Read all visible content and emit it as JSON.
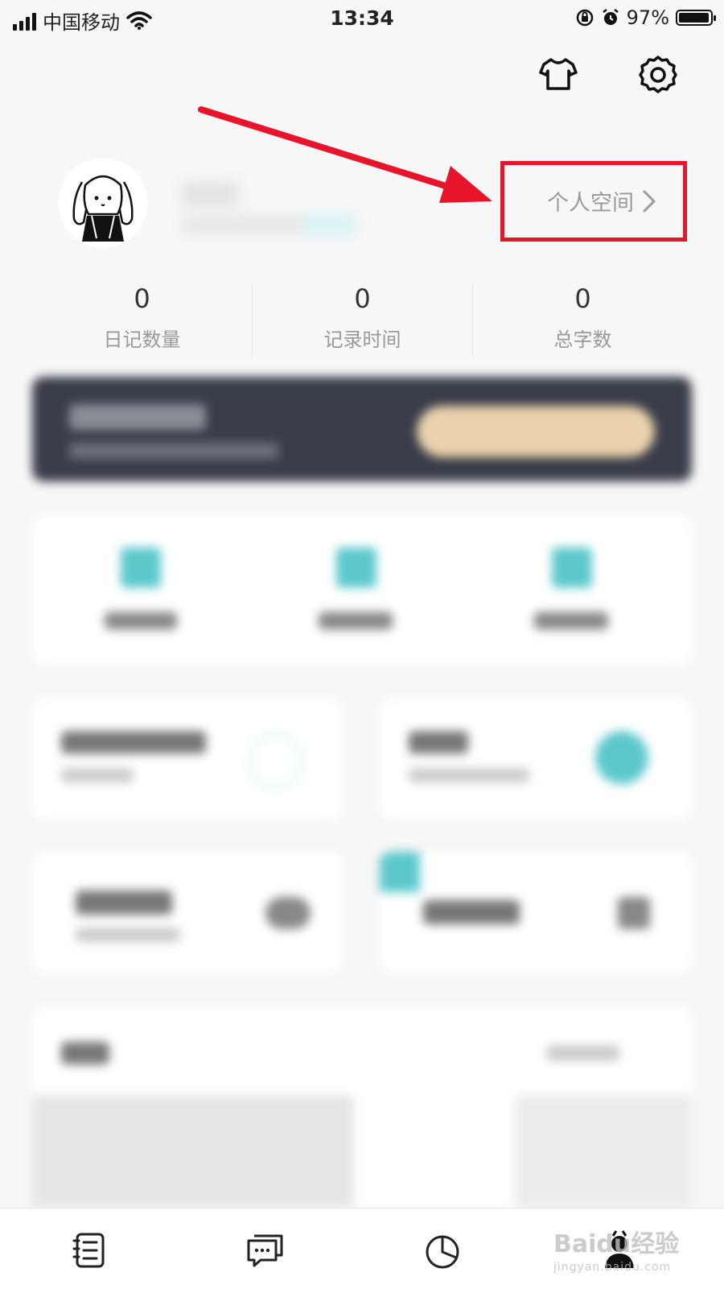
{
  "status_bar": {
    "carrier": "中国移动",
    "time": "13:34",
    "battery_percent": "97%",
    "battery_level": 0.97
  },
  "header": {
    "icons": [
      "tshirt-icon",
      "gear-icon"
    ]
  },
  "profile": {
    "space_link_label": "个人空间",
    "space_link_chevron": "›"
  },
  "stats": [
    {
      "value": "0",
      "label": "日记数量"
    },
    {
      "value": "0",
      "label": "记录时间"
    },
    {
      "value": "0",
      "label": "总字数"
    }
  ],
  "tab_bar": {
    "icons": [
      "diary-icon",
      "chat-icon",
      "chart-icon",
      "profile-icon"
    ]
  },
  "watermark": {
    "text": "Baidu经验",
    "subtext": "jingyan.baidu.com"
  },
  "colors": {
    "highlight": "#e8142b",
    "background": "#f7f7f7",
    "accent_teal": "#5cc8cc",
    "banner_dark": "#3a3d4a",
    "banner_button": "#ead2ad"
  }
}
